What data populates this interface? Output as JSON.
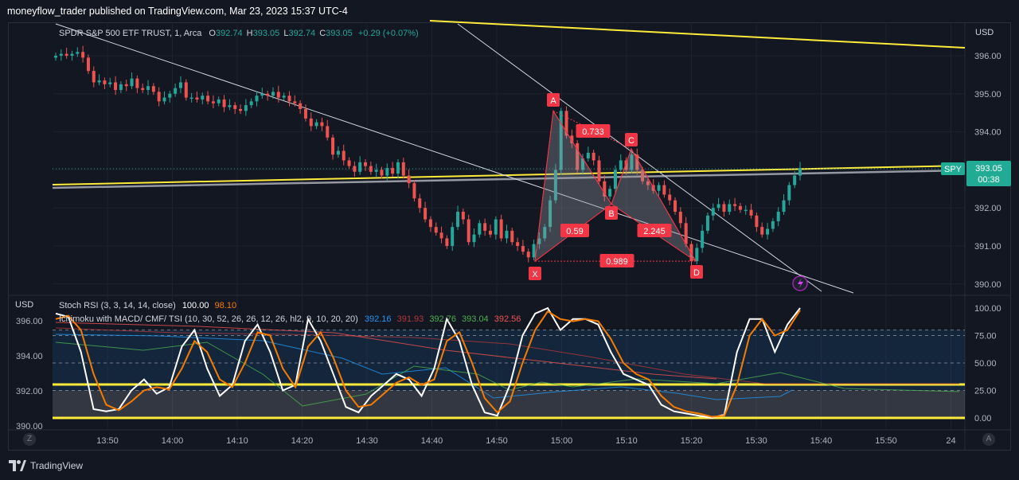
{
  "header": {
    "published": "moneyflow_trader published on TradingView.com, Mar 23, 2023 15:37 UTC-4"
  },
  "footer": {
    "brand": "TradingView",
    "left_btn": "Z",
    "right_btn": "A"
  },
  "colors": {
    "bg": "#131722",
    "up": "#26a69a",
    "down": "#ef5350",
    "pattern": "#f23645",
    "yellow": "#ffeb3b",
    "white": "#ffffff",
    "orange": "#f57c00",
    "blue": "#2196f3",
    "green": "#4caf50"
  },
  "main": {
    "symbol": "SPDR S&P 500 ETF TRUST, 1, Arca",
    "o_label": "O",
    "o_val": "392.74",
    "h_label": "H",
    "h_val": "393.05",
    "l_label": "L",
    "l_val": "392.74",
    "c_label": "C",
    "c_val": "393.05",
    "change": "+0.29 (+0.07%)",
    "currency": "USD",
    "ticker_badge": "SPY",
    "price_badge": "393.05",
    "timer_badge": "00:38"
  },
  "indicators": {
    "currency": "USD",
    "stoch_name": "Stoch RSI (3, 3, 14, 14, close)",
    "stoch_k": "100.00",
    "stoch_d": "98.10",
    "ichi_name": "Ichimoku with MACD/ CMF/ TSI (10, 30, 52, 26, 26, 12, 26, hl2, 9, 10, 20, 20)",
    "ichi_v1": "392.16",
    "ichi_v2": "391.93",
    "ichi_v3": "392.76",
    "ichi_v4": "393.04",
    "ichi_v5": "392.56"
  },
  "chart_data": [
    {
      "type": "candlestick",
      "title": "SPDR S&P 500 ETF TRUST, 1, Arca",
      "ylabel": "USD",
      "ylim": [
        389.9,
        396.3
      ],
      "yticks": [
        "396.00",
        "395.00",
        "394.00",
        "393.00",
        "392.00",
        "391.00",
        "390.00"
      ],
      "xticks": [
        "13:50",
        "14:00",
        "14:10",
        "14:20",
        "14:30",
        "14:40",
        "14:50",
        "15:00",
        "15:10",
        "15:20",
        "15:30",
        "15:40",
        "15:50",
        "24"
      ],
      "last_price": 393.05,
      "close_series": [
        396.0,
        396.05,
        396.0,
        396.05,
        396.1,
        395.95,
        395.6,
        395.3,
        395.35,
        395.25,
        395.3,
        395.1,
        395.25,
        395.2,
        395.4,
        395.15,
        395.1,
        395.2,
        395.05,
        394.8,
        394.9,
        395.0,
        395.15,
        395.3,
        394.9,
        394.9,
        394.85,
        394.95,
        394.8,
        394.75,
        394.85,
        394.65,
        394.7,
        394.6,
        394.55,
        394.7,
        394.8,
        394.95,
        395.0,
        394.95,
        395.05,
        394.9,
        394.95,
        394.8,
        394.75,
        394.6,
        394.35,
        394.15,
        394.25,
        394.15,
        393.85,
        393.4,
        393.5,
        393.25,
        393.1,
        392.95,
        393.2,
        393.1,
        392.95,
        393.0,
        392.85,
        393.05,
        392.9,
        393.2,
        392.85,
        392.65,
        392.25,
        392.0,
        391.7,
        391.5,
        391.35,
        391.2,
        391.0,
        391.5,
        391.9,
        391.7,
        391.1,
        391.3,
        391.6,
        391.4,
        391.3,
        391.7,
        391.2,
        391.4,
        391.1,
        391.0,
        390.85,
        390.7,
        391.05,
        391.2,
        391.5,
        392.2,
        393.0,
        394.55,
        393.9,
        393.7,
        393.0,
        393.3,
        393.45,
        393.25,
        392.7,
        392.3,
        392.5,
        393.0,
        393.25,
        393.0,
        393.4,
        393.0,
        392.7,
        392.6,
        392.45,
        392.6,
        392.35,
        392.2,
        391.9,
        391.6,
        391.05,
        390.6,
        390.95,
        391.4,
        391.8,
        392.0,
        392.1,
        391.9,
        392.1,
        392.05,
        391.95,
        391.95,
        391.8,
        391.5,
        391.3,
        391.45,
        391.65,
        391.9,
        392.2,
        392.6,
        392.85,
        393.05
      ],
      "harmonic_pattern": {
        "points": [
          {
            "name": "X",
            "value": 390.6
          },
          {
            "name": "A",
            "value": 394.55
          },
          {
            "name": "B",
            "value": 392.1
          },
          {
            "name": "C",
            "value": 393.55
          },
          {
            "name": "D",
            "value": 390.6
          }
        ],
        "ratios": [
          "0.733",
          "0.59",
          "2.245",
          "0.989"
        ]
      }
    },
    {
      "type": "line",
      "title": "Stoch RSI (3, 3, 14, 14, close)",
      "ylim": [
        0,
        100
      ],
      "yticks": [
        "100.00",
        "75.00",
        "50.00",
        "25.00",
        "0.00"
      ],
      "secondary_yticks": [
        "396.00",
        "394.00",
        "392.00",
        "390.00"
      ],
      "series": [
        {
          "name": "K",
          "color": "#ffffff",
          "values": [
            95,
            92,
            60,
            8,
            6,
            8,
            25,
            35,
            22,
            28,
            65,
            80,
            45,
            20,
            30,
            70,
            85,
            60,
            25,
            30,
            90,
            70,
            40,
            10,
            5,
            20,
            30,
            40,
            35,
            20,
            45,
            90,
            70,
            30,
            5,
            2,
            30,
            75,
            95,
            100,
            80,
            90,
            90,
            85,
            60,
            40,
            35,
            30,
            12,
            6,
            4,
            2,
            0,
            3,
            60,
            90,
            90,
            60,
            85,
            100
          ]
        },
        {
          "name": "D",
          "color": "#f57c00",
          "values": [
            90,
            93,
            80,
            40,
            12,
            7,
            15,
            25,
            28,
            26,
            45,
            70,
            60,
            35,
            28,
            50,
            78,
            75,
            45,
            28,
            65,
            78,
            55,
            25,
            10,
            12,
            22,
            32,
            37,
            30,
            35,
            70,
            78,
            50,
            18,
            5,
            15,
            50,
            80,
            97,
            90,
            88,
            90,
            88,
            72,
            50,
            40,
            35,
            20,
            10,
            6,
            4,
            1,
            2,
            30,
            75,
            90,
            75,
            80,
            98
          ]
        }
      ]
    }
  ]
}
